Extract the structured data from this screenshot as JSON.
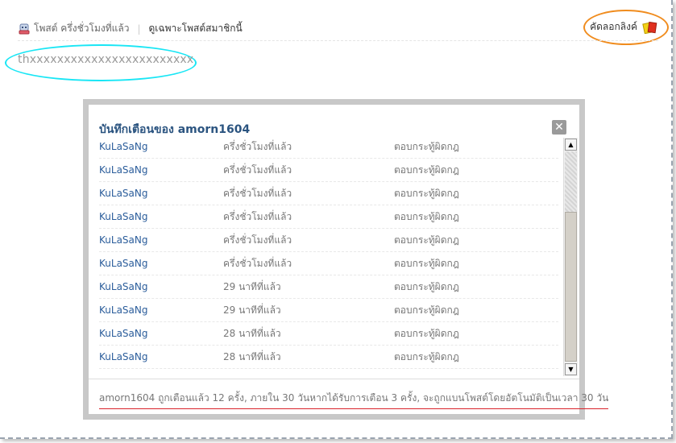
{
  "topbar": {
    "post_time": "โพสต์ ครึ่งชั่วโมงที่แล้ว",
    "only_member": "ดูเฉพาะโพสต์สมาชิกนี้",
    "copy_link": "คัดลอกลิงค์"
  },
  "post": {
    "text": "thxxxxxxxxxxxxxxxxxxxxxxxx"
  },
  "dialog": {
    "title": "บันทึกเตือนของ amorn1604",
    "close_glyph": "✕",
    "rows": [
      {
        "user": "KuLaSaNg",
        "time": "ครึ่งชั่วโมงที่แล้ว",
        "reason": "ตอบกระทู้ผิดกฎ"
      },
      {
        "user": "KuLaSaNg",
        "time": "ครึ่งชั่วโมงที่แล้ว",
        "reason": "ตอบกระทู้ผิดกฎ"
      },
      {
        "user": "KuLaSaNg",
        "time": "ครึ่งชั่วโมงที่แล้ว",
        "reason": "ตอบกระทู้ผิดกฎ"
      },
      {
        "user": "KuLaSaNg",
        "time": "ครึ่งชั่วโมงที่แล้ว",
        "reason": "ตอบกระทู้ผิดกฎ"
      },
      {
        "user": "KuLaSaNg",
        "time": "ครึ่งชั่วโมงที่แล้ว",
        "reason": "ตอบกระทู้ผิดกฎ"
      },
      {
        "user": "KuLaSaNg",
        "time": "ครึ่งชั่วโมงที่แล้ว",
        "reason": "ตอบกระทู้ผิดกฎ"
      },
      {
        "user": "KuLaSaNg",
        "time": "29 นาทีที่แล้ว",
        "reason": "ตอบกระทู้ผิดกฎ"
      },
      {
        "user": "KuLaSaNg",
        "time": "29 นาทีที่แล้ว",
        "reason": "ตอบกระทู้ผิดกฎ"
      },
      {
        "user": "KuLaSaNg",
        "time": "28 นาทีที่แล้ว",
        "reason": "ตอบกระทู้ผิดกฎ"
      },
      {
        "user": "KuLaSaNg",
        "time": "28 นาทีที่แล้ว",
        "reason": "ตอบกระทู้ผิดกฎ"
      }
    ],
    "footer": "amorn1604 ถูกเตือนแล้ว 12 ครั้ง, ภายใน 30 วันหากได้รับการเตือน 3 ครั้ง, จะถูกแบนโพสต์โดยอัตโนมัติเป็นเวลา 30 วัน"
  },
  "colors": {
    "copy_link_highlight": "#f08c1e",
    "post_highlight": "#19e6f5",
    "footer_underline": "#d9222a",
    "link_blue": "#2b5d9b"
  },
  "icons": {
    "post_time": "robot-icon",
    "copy_link": "card-icon",
    "close": "close-icon"
  }
}
